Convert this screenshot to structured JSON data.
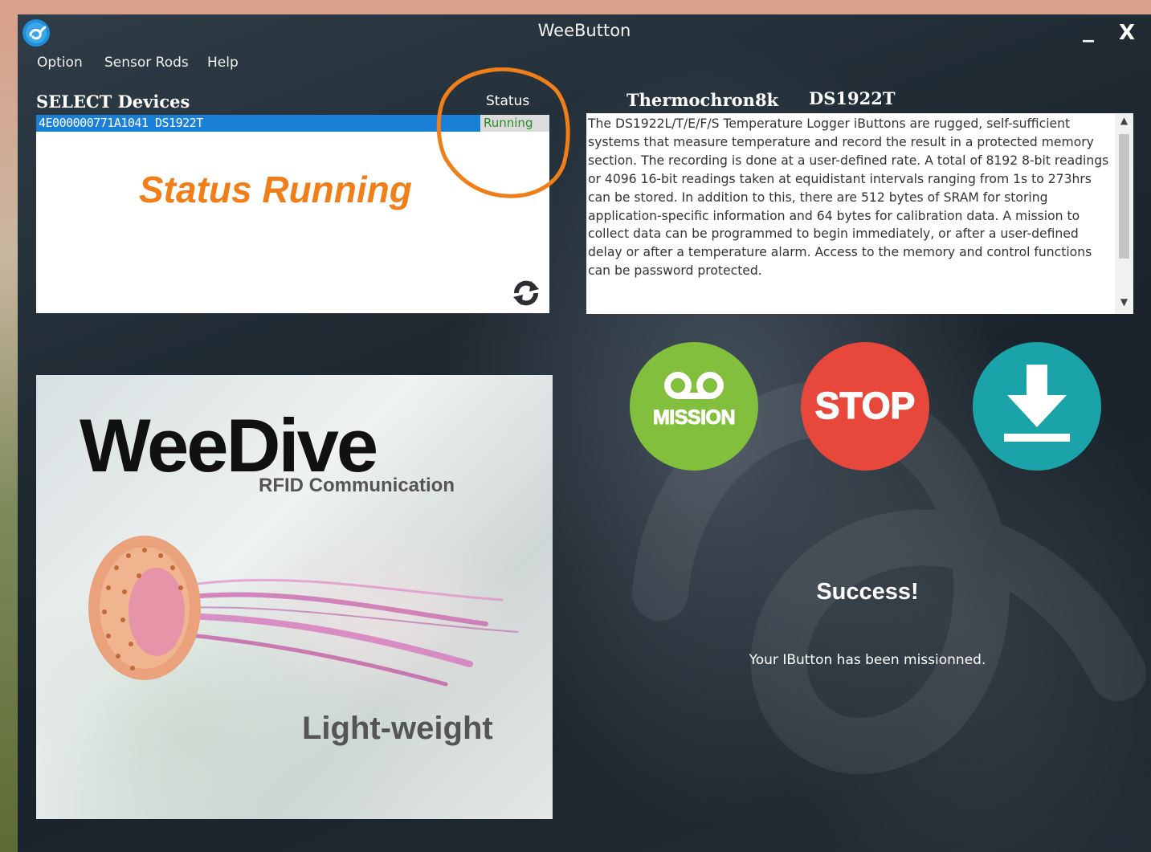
{
  "window": {
    "title": "WeeButton"
  },
  "titlebar": {
    "minimize_symbol": "_",
    "close_symbol": "X"
  },
  "menu": {
    "items": [
      "Option",
      "Sensor Rods",
      "Help"
    ]
  },
  "devices": {
    "heading": "SELECT Devices",
    "status_header": "Status",
    "rows": [
      {
        "id": "4E000000771A1041 DS1922T",
        "status": "Running"
      }
    ]
  },
  "annotation": {
    "text": "Status Running",
    "color": "#f07f1a"
  },
  "device_info": {
    "name": "Thermochron8k",
    "model": "DS1922T",
    "description": "The DS1922L/T/E/F/S Temperature Logger iButtons are rugged, self-sufficient systems that measure temperature and record the result in a protected memory section. The recording is done at a user-defined rate. A total of 8192 8-bit readings or 4096 16-bit readings taken at equidistant intervals ranging from 1s to 273hrs can be stored. In addition to this, there are 512 bytes of SRAM for storing application-specific information and 64 bytes for calibration data. A mission to collect data can be programmed to begin immediately, or after a user-defined delay or after a temperature alarm. Access to the memory and control functions can be password protected."
  },
  "promo": {
    "title": "WeeDive",
    "subtitle": "RFID Communication",
    "tagline": "Light-weight"
  },
  "actions": {
    "mission_label": "MISSION",
    "stop_label": "STOP",
    "colors": {
      "mission": "#82bf3c",
      "stop": "#e8483b",
      "download": "#1aa3a8"
    },
    "download_icon": "download-arrow-icon"
  },
  "result": {
    "title": "Success!",
    "message": "Your IButton has been missionned."
  },
  "icons": {
    "app": "app-logo-icon",
    "refresh": "refresh-icon",
    "voicemail": "voicemail-icon"
  }
}
